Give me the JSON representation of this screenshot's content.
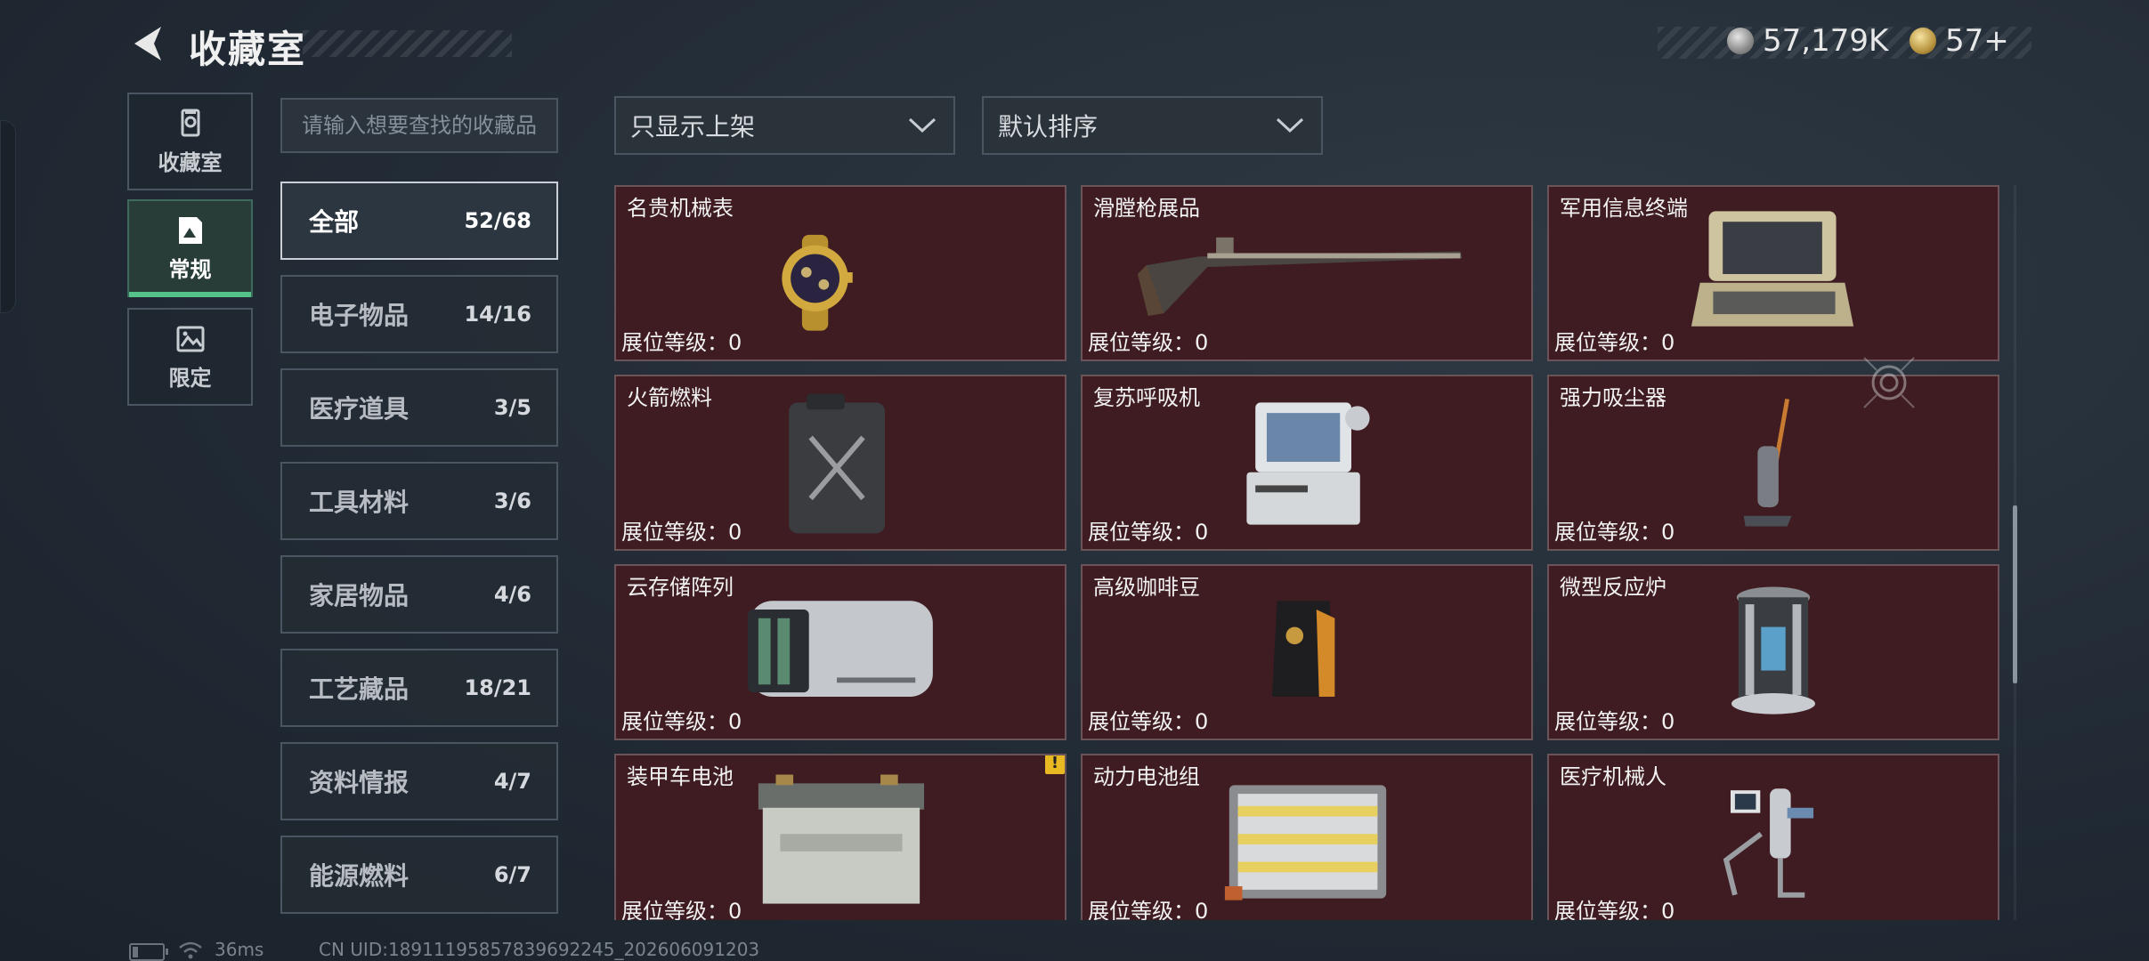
{
  "header": {
    "title": "收藏室",
    "currency": [
      {
        "icon": "silver-coin-icon",
        "value": "57,179K"
      },
      {
        "icon": "gold-coin-icon",
        "value": "57+"
      }
    ]
  },
  "nav": [
    {
      "label": "收藏室",
      "icon": "collection-room-icon",
      "active": false
    },
    {
      "label": "常规",
      "icon": "regular-doc-icon",
      "active": true
    },
    {
      "label": "限定",
      "icon": "limited-image-icon",
      "active": false
    }
  ],
  "search": {
    "placeholder": "请输入想要查找的收藏品"
  },
  "categories": [
    {
      "name": "全部",
      "count": "52/68",
      "active": true
    },
    {
      "name": "电子物品",
      "count": "14/16"
    },
    {
      "name": "医疗道具",
      "count": "3/5"
    },
    {
      "name": "工具材料",
      "count": "3/6"
    },
    {
      "name": "家居物品",
      "count": "4/6"
    },
    {
      "name": "工艺藏品",
      "count": "18/21"
    },
    {
      "name": "资料情报",
      "count": "4/7"
    },
    {
      "name": "能源燃料",
      "count": "6/7"
    }
  ],
  "filters": {
    "display": "只显示上架",
    "sort": "默认排序"
  },
  "items": [
    {
      "name": "名贵机械表",
      "level": "展位等级：0",
      "icon": "gold-watch-icon"
    },
    {
      "name": "滑膛枪展品",
      "level": "展位等级：0",
      "icon": "musket-icon"
    },
    {
      "name": "军用信息终端",
      "level": "展位等级：0",
      "icon": "rugged-terminal-icon"
    },
    {
      "name": "火箭燃料",
      "level": "展位等级：0",
      "icon": "fuel-canister-icon"
    },
    {
      "name": "复苏呼吸机",
      "level": "展位等级：0",
      "icon": "ventilator-icon"
    },
    {
      "name": "强力吸尘器",
      "level": "展位等级：0",
      "icon": "vacuum-cleaner-icon"
    },
    {
      "name": "云存储阵列",
      "level": "展位等级：0",
      "icon": "storage-array-icon"
    },
    {
      "name": "高级咖啡豆",
      "level": "展位等级：0",
      "icon": "coffee-bag-icon"
    },
    {
      "name": "微型反应炉",
      "level": "展位等级：0",
      "icon": "mini-reactor-icon"
    },
    {
      "name": "装甲车电池",
      "level": "展位等级：0",
      "icon": "car-battery-icon",
      "warning": "!"
    },
    {
      "name": "动力电池组",
      "level": "展位等级：0",
      "icon": "battery-pack-icon"
    },
    {
      "name": "医疗机械人",
      "level": "展位等级：0",
      "icon": "medical-robot-icon"
    }
  ],
  "footer": {
    "ping": "36ms",
    "uid": "CN UID:18911195857839692245_202606091203"
  }
}
